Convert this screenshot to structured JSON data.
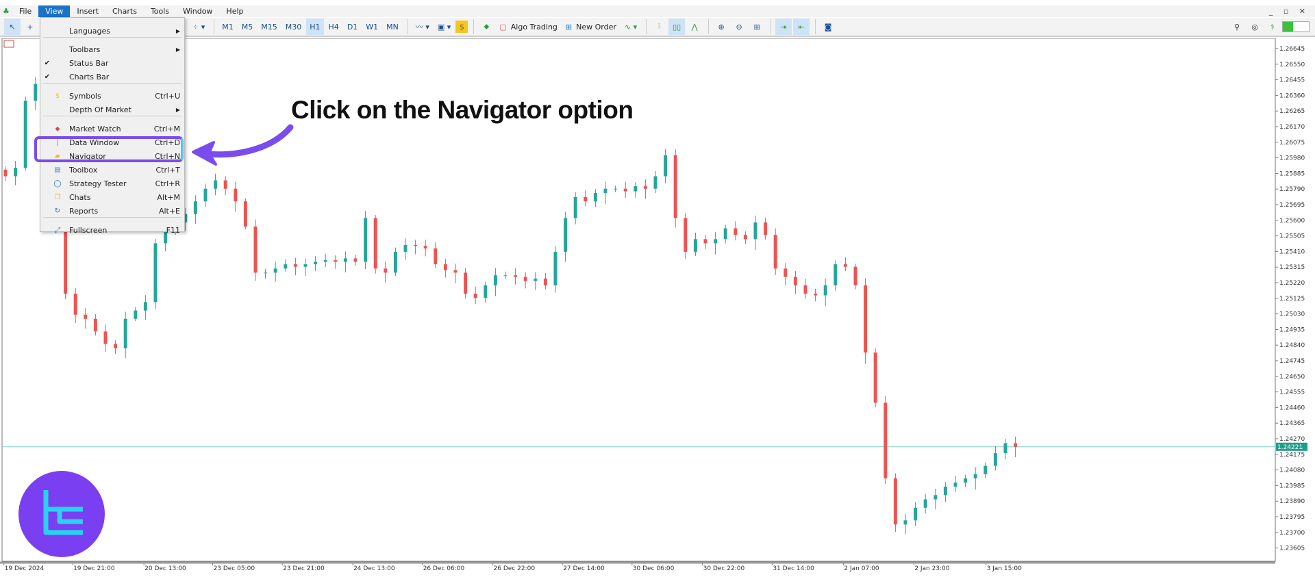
{
  "menubar": {
    "items": [
      "File",
      "View",
      "Insert",
      "Charts",
      "Tools",
      "Window",
      "Help"
    ],
    "active": "View"
  },
  "toolbar": {
    "timeframes": [
      "M1",
      "M5",
      "M15",
      "M30",
      "H1",
      "H4",
      "D1",
      "W1",
      "MN"
    ],
    "selected_timeframe": "H1",
    "algo_trading": "Algo Trading",
    "new_order": "New Order"
  },
  "view_menu": {
    "items": [
      {
        "label": "Languages",
        "shortcut": "",
        "submenu": true,
        "checked": false,
        "icon": ""
      },
      {
        "label": "Toolbars",
        "shortcut": "",
        "submenu": true,
        "checked": false,
        "icon": ""
      },
      {
        "label": "Status Bar",
        "shortcut": "",
        "submenu": false,
        "checked": true,
        "icon": ""
      },
      {
        "label": "Charts Bar",
        "shortcut": "",
        "submenu": false,
        "checked": true,
        "icon": ""
      },
      {
        "label": "Symbols",
        "shortcut": "Ctrl+U",
        "submenu": false,
        "checked": false,
        "icon": "dollar-icon"
      },
      {
        "label": "Depth Of Market",
        "shortcut": "",
        "submenu": true,
        "checked": false,
        "icon": ""
      },
      {
        "label": "Market Watch",
        "shortcut": "Ctrl+M",
        "submenu": false,
        "checked": false,
        "icon": "market-watch-icon"
      },
      {
        "label": "Data Window",
        "shortcut": "Ctrl+D",
        "submenu": false,
        "checked": false,
        "icon": "data-window-icon"
      },
      {
        "label": "Navigator",
        "shortcut": "Ctrl+N",
        "submenu": false,
        "checked": false,
        "icon": "folder-icon"
      },
      {
        "label": "Toolbox",
        "shortcut": "Ctrl+T",
        "submenu": false,
        "checked": false,
        "icon": "toolbox-icon"
      },
      {
        "label": "Strategy Tester",
        "shortcut": "Ctrl+R",
        "submenu": false,
        "checked": false,
        "icon": "tester-icon"
      },
      {
        "label": "Chats",
        "shortcut": "Alt+M",
        "submenu": false,
        "checked": false,
        "icon": "chat-icon"
      },
      {
        "label": "Reports",
        "shortcut": "Alt+E",
        "submenu": false,
        "checked": false,
        "icon": "reports-icon"
      },
      {
        "label": "Fullscreen",
        "shortcut": "F11",
        "submenu": false,
        "checked": false,
        "icon": "fullscreen-icon"
      }
    ]
  },
  "callout": {
    "text": "Click on the Navigator option",
    "color": "#7a4cf0"
  },
  "colors": {
    "bull": "#26a69a",
    "bear": "#ef5350",
    "current_line": "#7fd0c0",
    "current_bg": "#1f9e8a",
    "menu_highlight": "#7a4cf0",
    "logo": "#7b3ff2"
  },
  "chart_data": {
    "type": "candlestick",
    "timeframe": "H1",
    "current_price": "1.24221",
    "y_ticks": [
      "1.26645",
      "1.26550",
      "1.26455",
      "1.26360",
      "1.26265",
      "1.26170",
      "1.26075",
      "1.25980",
      "1.25885",
      "1.25790",
      "1.25695",
      "1.25600",
      "1.25505",
      "1.25410",
      "1.25315",
      "1.25220",
      "1.25125",
      "1.25030",
      "1.24935",
      "1.24840",
      "1.24745",
      "1.24650",
      "1.24555",
      "1.24460",
      "1.24365",
      "1.24270",
      "1.24175",
      "1.24080",
      "1.23985",
      "1.23890",
      "1.23795",
      "1.23700",
      "1.23605"
    ],
    "x_ticks": [
      "19 Dec 2024",
      "19 Dec 21:00",
      "20 Dec 13:00",
      "23 Dec 05:00",
      "23 Dec 21:00",
      "24 Dec 13:00",
      "26 Dec 06:00",
      "26 Dec 22:00",
      "27 Dec 14:00",
      "30 Dec 06:00",
      "30 Dec 22:00",
      "31 Dec 14:00",
      "2 Jan 07:00",
      "2 Jan 23:00",
      "3 Jan 15:00"
    ],
    "ylim": [
      1.2356,
      1.2668
    ],
    "closes": [
      1.25868,
      1.25919,
      1.26328,
      1.2643,
      1.26022,
      1.25562,
      1.25153,
      1.25025,
      1.25,
      1.24923,
      1.24847,
      1.24821,
      1.25,
      1.25051,
      1.25102,
      1.2546,
      1.25536,
      1.25587,
      1.25638,
      1.25715,
      1.25792,
      1.25843,
      1.25792,
      1.25715,
      1.25562,
      1.25281,
      1.25281,
      1.25306,
      1.25332,
      1.25317,
      1.25332,
      1.25347,
      1.25357,
      1.25347,
      1.25368,
      1.25347,
      1.25613,
      1.25306,
      1.25281,
      1.25408,
      1.25449,
      1.25444,
      1.25429,
      1.25332,
      1.25296,
      1.25281,
      1.25153,
      1.25127,
      1.25204,
      1.25265,
      1.25265,
      1.25255,
      1.2523,
      1.25245,
      1.25204,
      1.25408,
      1.25613,
      1.25741,
      1.25715,
      1.25766,
      1.25792,
      1.25792,
      1.25776,
      1.25807,
      1.25792,
      1.25868,
      1.25996,
      1.25613,
      1.25408,
      1.25485,
      1.2546,
      1.25485,
      1.25551,
      1.25511,
      1.25485,
      1.25587,
      1.25511,
      1.25306,
      1.25255,
      1.25204,
      1.25153,
      1.25143,
      1.25204,
      1.25332,
      1.25317,
      1.25204,
      1.24795,
      1.24489,
      1.24029,
      1.23748,
      1.23773,
      1.2385,
      1.23901,
      1.23927,
      1.23978,
      1.24003,
      1.24029,
      1.24054,
      1.24105,
      1.24182,
      1.24243,
      1.24221
    ]
  }
}
